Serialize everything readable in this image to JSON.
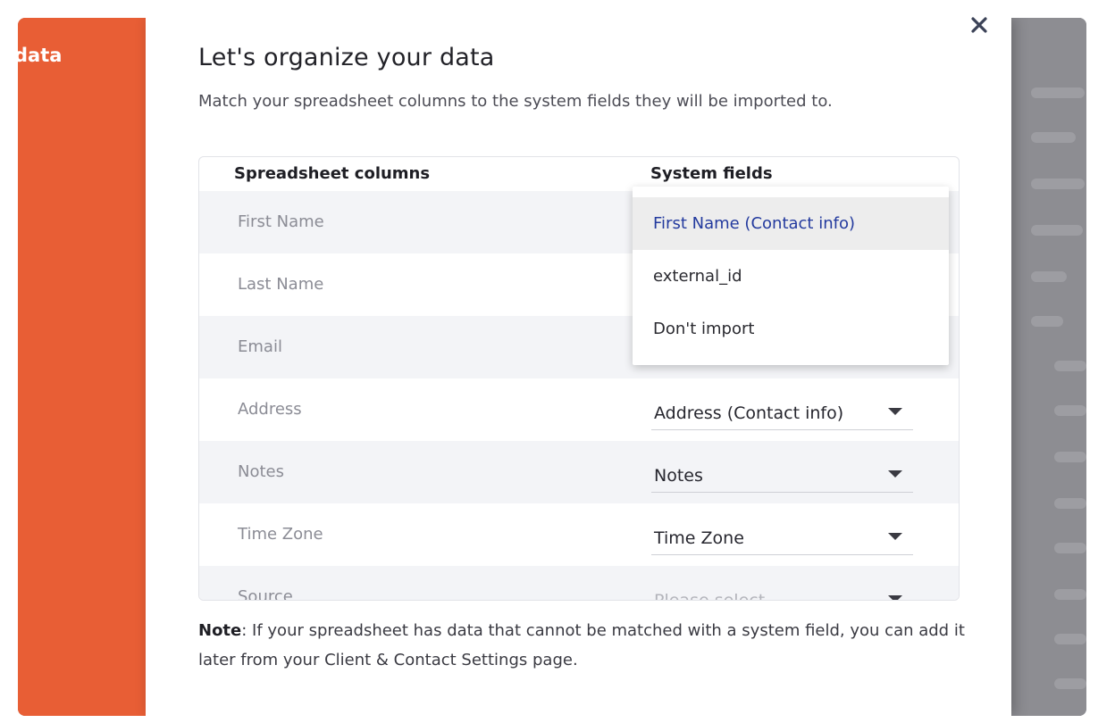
{
  "sidebar": {
    "label": "data"
  },
  "modal": {
    "title": "Let's organize your data",
    "subtitle": "Match your spreadsheet columns to the system fields they will be imported to.",
    "close_icon": "close-icon"
  },
  "table": {
    "headers": {
      "spreadsheet": "Spreadsheet columns",
      "system": "System fields"
    },
    "rows": [
      {
        "column": "First Name",
        "field": ""
      },
      {
        "column": "Last Name",
        "field": ""
      },
      {
        "column": "Email",
        "field": ""
      },
      {
        "column": "Address",
        "field": "Address (Contact info)"
      },
      {
        "column": "Notes",
        "field": "Notes"
      },
      {
        "column": "Time Zone",
        "field": "Time Zone"
      },
      {
        "column": "Source",
        "field": "Please select"
      }
    ]
  },
  "dropdown": {
    "options": [
      "First Name (Contact info)",
      "external_id",
      "Don't import"
    ],
    "selected_index": 0
  },
  "note": {
    "bold": "Note",
    "text": ": If your spreadsheet has data that cannot be matched with a system field, you can add it later from your Client & Contact Settings page."
  },
  "colors": {
    "sidebar": "#e85e35",
    "selected_option": "#233a9e"
  }
}
